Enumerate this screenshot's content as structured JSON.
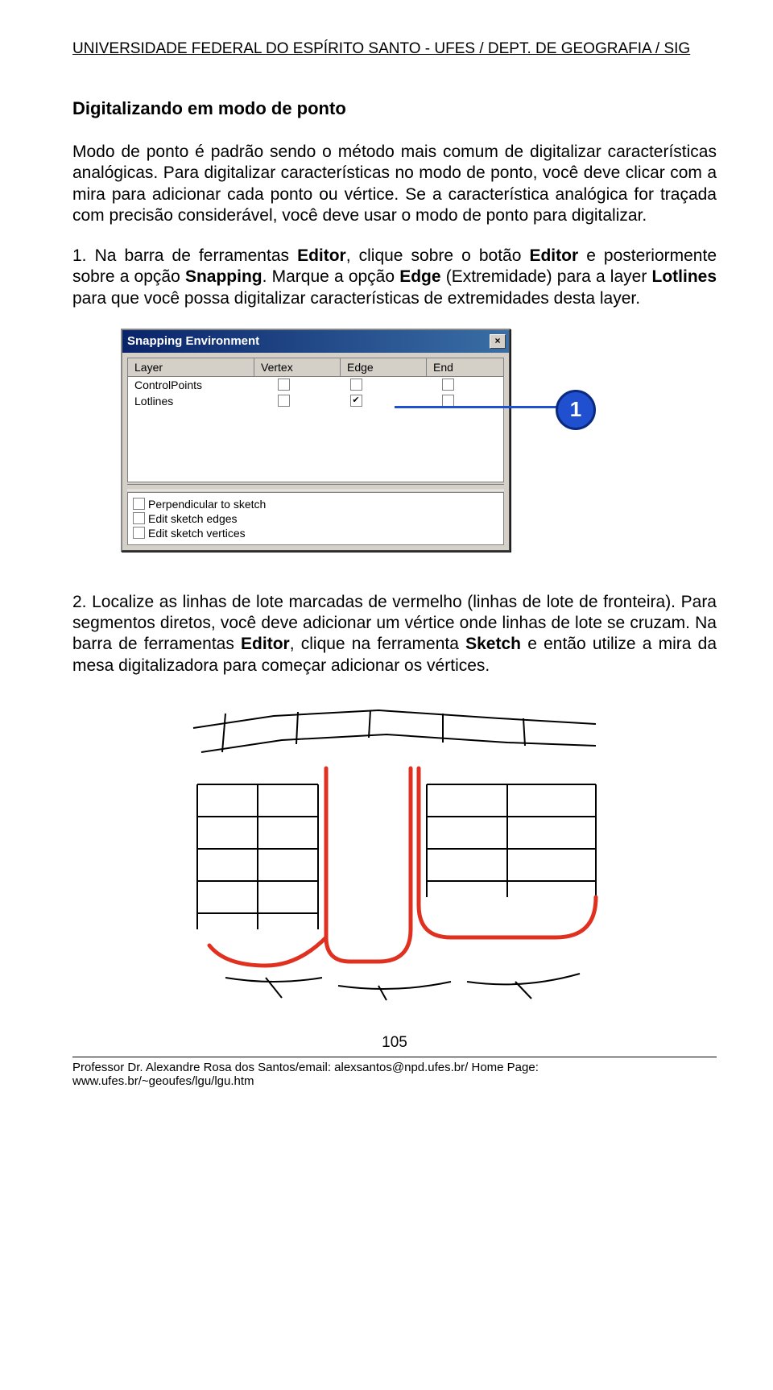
{
  "header": "UNIVERSIDADE FEDERAL DO ESPÍRITO SANTO - UFES / DEPT. DE GEOGRAFIA / SIG",
  "section_title": "Digitalizando em modo de ponto",
  "intro": "Modo de ponto é padrão sendo o método mais comum de digitalizar características analógicas. Para digitalizar características no modo de ponto, você deve clicar com a mira para adicionar cada ponto ou vértice. Se a característica analógica for traçada com precisão considerável, você deve usar o modo de ponto para digitalizar.",
  "step1_pre": "1. Na barra de ferramentas ",
  "step1_b1": "Editor",
  "step1_mid1": ", clique sobre o botão ",
  "step1_b2": "Editor",
  "step1_mid2": " e posteriormente sobre a opção ",
  "step1_b3": "Snapping",
  "step1_mid3": ". Marque a opção ",
  "step1_b4": "Edge",
  "step1_mid4": " (Extremidade) para a layer ",
  "step1_b5": "Lotlines",
  "step1_post": " para que você possa digitalizar características de extremidades desta layer.",
  "win": {
    "title": "Snapping Environment",
    "close": "×",
    "cols": {
      "layer": "Layer",
      "vertex": "Vertex",
      "edge": "Edge",
      "end": "End"
    },
    "rows": [
      {
        "layer": "ControlPoints",
        "vertex": false,
        "edge": false,
        "end": false
      },
      {
        "layer": "Lotlines",
        "vertex": false,
        "edge": true,
        "end": false
      }
    ],
    "opts": [
      "Perpendicular to sketch",
      "Edit sketch edges",
      "Edit sketch vertices"
    ]
  },
  "callout": "1",
  "step2_pre": "2. Localize as linhas de lote marcadas de vermelho (linhas de lote de fronteira). Para segmentos diretos, você deve adicionar um vértice onde linhas de lote se cruzam. Na barra de ferramentas ",
  "step2_b1": "Editor",
  "step2_mid1": ", clique na ferramenta ",
  "step2_b2": "Sketch",
  "step2_post": " e então utilize a mira da mesa digitalizadora para começar adicionar os vértices.",
  "page_number": "105",
  "footer": "Professor Dr. Alexandre Rosa dos Santos/email: alexsantos@npd.ufes.br/ Home Page: www.ufes.br/~geoufes/lgu/lgu.htm"
}
